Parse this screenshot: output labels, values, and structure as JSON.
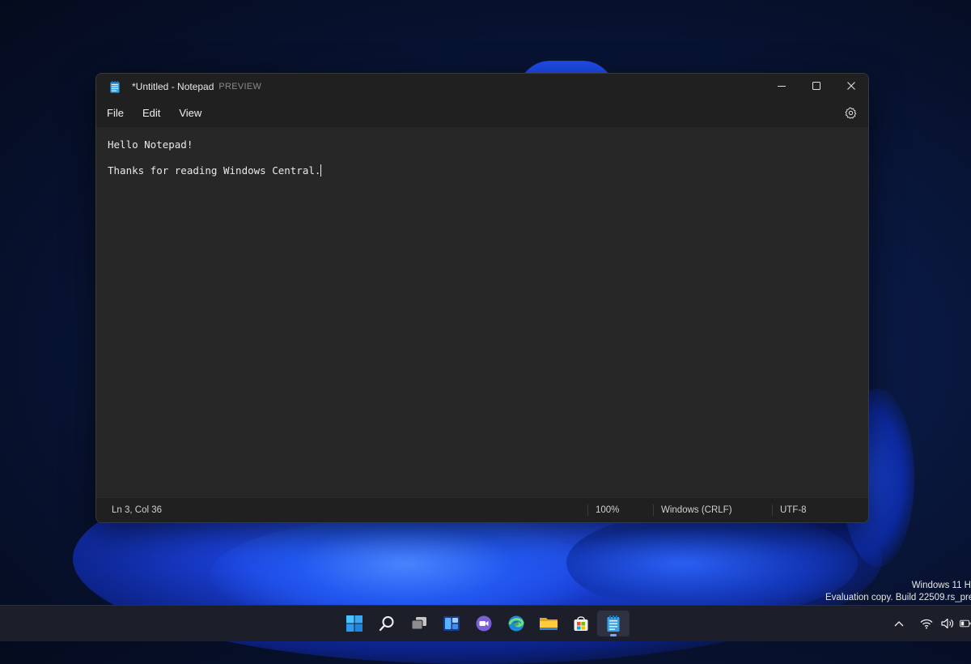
{
  "window": {
    "title": "*Untitled - Notepad",
    "title_badge": "PREVIEW"
  },
  "menu": {
    "file": "File",
    "edit": "Edit",
    "view": "View"
  },
  "editor": {
    "lines": [
      "Hello Notepad!",
      "Thanks for reading Windows Central."
    ]
  },
  "status": {
    "position": "Ln 3, Col 36",
    "zoom": "100%",
    "line_ending": "Windows (CRLF)",
    "encoding": "UTF-8"
  },
  "desktop": {
    "watermark_line1": "Windows 11 H",
    "watermark_line2": "Evaluation copy. Build 22509.rs_pre"
  },
  "taskbar": {
    "icons": [
      "start-icon",
      "search-icon",
      "task-view-icon",
      "widgets-icon",
      "chat-icon",
      "edge-icon",
      "file-explorer-icon",
      "store-icon",
      "notepad-icon"
    ],
    "active": "notepad-icon",
    "tray_icons": [
      "chevron-up-icon",
      "wifi-icon",
      "volume-icon",
      "battery-icon"
    ]
  },
  "colors": {
    "window_bg": "#202020",
    "editor_bg": "#272727",
    "accent": "#7aa7ff",
    "taskbar_bg": "#1c1f2a"
  }
}
